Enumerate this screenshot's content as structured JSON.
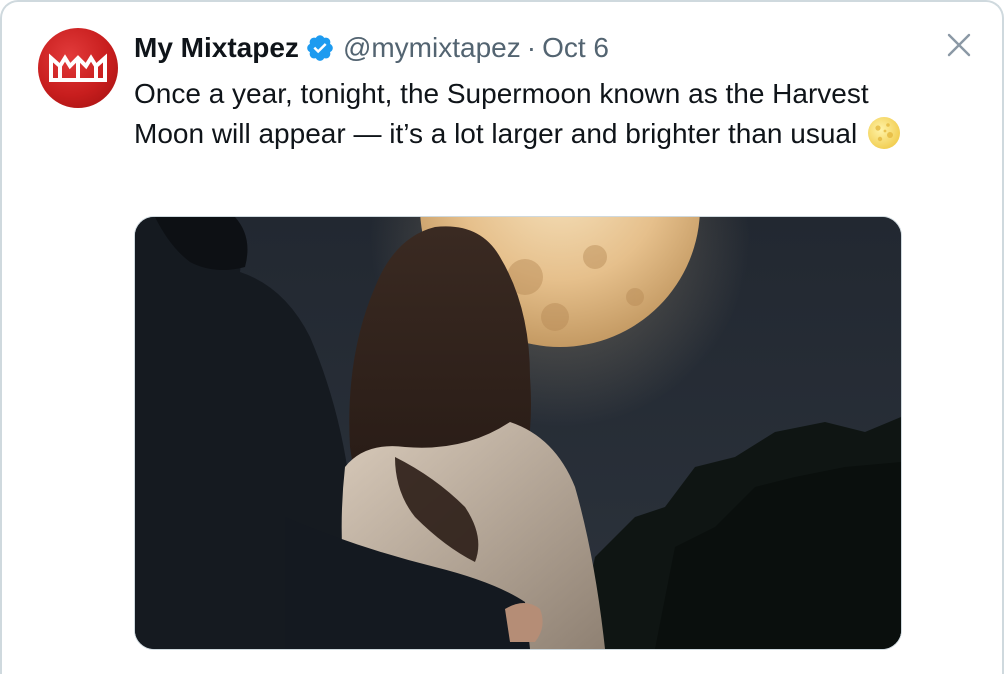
{
  "tweet": {
    "author_name": "My Mixtapez",
    "handle": "@mymixtapez",
    "separator": "·",
    "date": "Oct 6",
    "text": "Once a year, tonight, the Supermoon known as the Harvest Moon will appear — it’s a lot larger and brighter than usual",
    "emoji": "full-moon-emoji",
    "verified": true,
    "avatar_logo": "MM"
  },
  "icons": {
    "verified": "verified-badge-icon",
    "close": "close-icon"
  },
  "colors": {
    "verified_blue": "#1d9bf0",
    "avatar_red": "#c81e1e",
    "text_primary": "#0f1419",
    "text_secondary": "#536471"
  }
}
